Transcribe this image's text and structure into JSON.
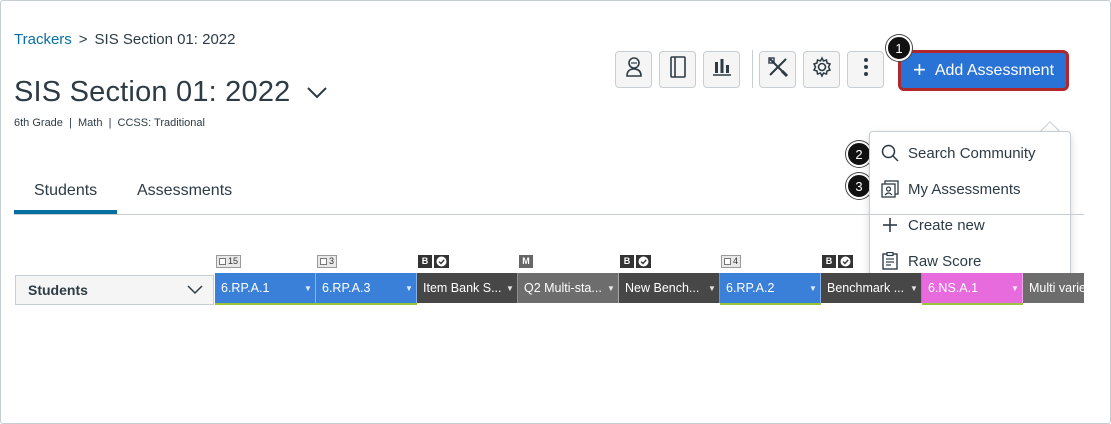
{
  "breadcrumb": {
    "root": "Trackers",
    "separator": ">",
    "current": "SIS Section 01: 2022"
  },
  "page": {
    "title": "SIS Section 01: 2022",
    "subtitle": "6th Grade  |  Math  |  CCSS: Traditional"
  },
  "toolbar": {
    "icons": [
      "student-view-icon",
      "notebook-icon",
      "bar-chart-icon",
      "tools-icon",
      "gear-icon",
      "kebab-menu-icon"
    ]
  },
  "add_button": {
    "label": "Add Assessment",
    "plus": "+"
  },
  "badges": {
    "b1": "1",
    "b2": "2",
    "b3": "3"
  },
  "menu": {
    "items": [
      {
        "label": "Search Community",
        "icon": "search-icon"
      },
      {
        "label": "My Assessments",
        "icon": "my-assessments-icon"
      },
      {
        "label": "Create new",
        "icon": "plus-icon"
      },
      {
        "label": "Raw Score",
        "icon": "clipboard-icon"
      }
    ]
  },
  "tabs": {
    "students": "Students",
    "assessments": "Assessments"
  },
  "grid": {
    "students_header": "Students",
    "columns": [
      {
        "tag_type": "count",
        "tag": "15",
        "label": "6.RP.A.1",
        "color": "#3a80d9",
        "strip": "#9bc43a"
      },
      {
        "tag_type": "count",
        "tag": "3",
        "label": "6.RP.A.3",
        "color": "#3a80d9",
        "strip": "#9bc43a"
      },
      {
        "tag_type": "benchmark",
        "tag": "B",
        "label": "Item Bank S...",
        "color": "#474747",
        "strip": ""
      },
      {
        "tag_type": "multi",
        "tag": "M",
        "label": "Q2 Multi-sta...",
        "color": "#6d6d6d",
        "strip": ""
      },
      {
        "tag_type": "benchmark",
        "tag": "B",
        "label": "New Bench...",
        "color": "#474747",
        "strip": ""
      },
      {
        "tag_type": "count",
        "tag": "4",
        "label": "6.RP.A.2",
        "color": "#3a80d9",
        "strip": "#9bc43a"
      },
      {
        "tag_type": "benchmark",
        "tag": "B",
        "label": "Benchmark ...",
        "color": "#474747",
        "strip": ""
      },
      {
        "tag_type": "none",
        "tag": "",
        "label": "6.NS.A.1",
        "color": "#e86bde",
        "strip": "#9bc43a"
      },
      {
        "tag_type": "none",
        "tag": "",
        "label": "Multi varie",
        "color": "#6d6d6d",
        "strip": ""
      }
    ]
  },
  "colors": {
    "primary": "#2a73d6",
    "focus_ring": "#b1282c",
    "link": "#0770a3"
  }
}
